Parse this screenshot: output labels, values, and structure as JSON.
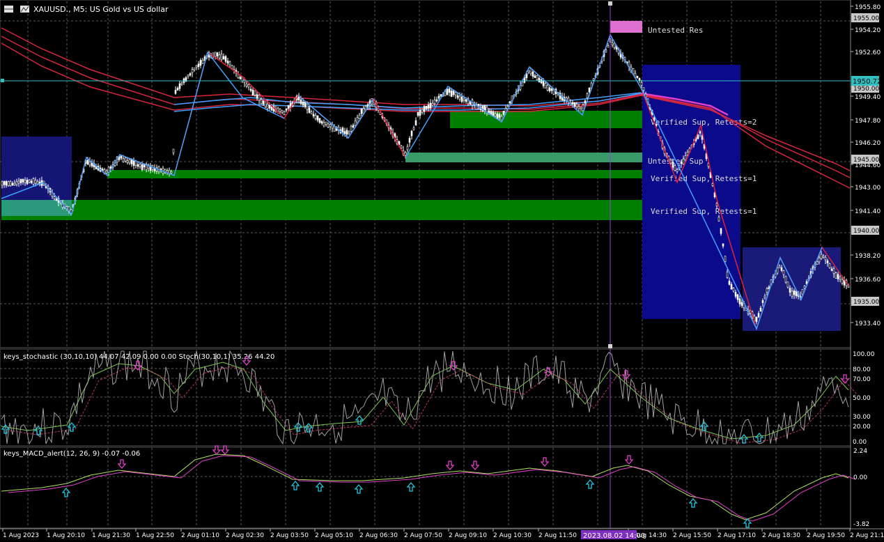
{
  "header": {
    "symbol_title": "XAUUSD., M5:  US Gold vs US dollar"
  },
  "colors": {
    "background": "#000000",
    "grid": "#787878",
    "candle": "#ffffff",
    "ema_red": "#d7263d",
    "ema_blue": "#3ea0ff",
    "magenta": "#e040c8",
    "supply_zone": "#e46fd0",
    "demand_zone": "#008000",
    "untested_sup": "#3aa070",
    "session_box": "#0a0a80",
    "arrow_up": "#22c8e0",
    "arrow_down": "#e040c8",
    "stoch_main": "#7cc84a",
    "stoch_signal": "#c03060",
    "stoch_raw": "#a0a0a0",
    "macd_main": "#b0e060",
    "macd_signal": "#e040c8",
    "crosshair": "#a040e0",
    "current_price_line": "#30c0c0"
  },
  "main_chart": {
    "price_labels": [
      "1955.80",
      "1954.20",
      "1952.60",
      "1949.40",
      "1947.80",
      "1946.20",
      "1944.60",
      "1943.00",
      "1941.40",
      "1938.20",
      "1936.60",
      "1933.40"
    ],
    "highlighted_price_labels": [
      "1955.00",
      "1950.00",
      "1945.00",
      "1940.00",
      "1935.00"
    ],
    "current_price": "1950.72",
    "zone_labels": {
      "untested_res": "Untested Res",
      "verified_sup_2": "Verified Sup, Retests=2",
      "untested_sup": "Untested Sup",
      "verified_sup_1a": "Verified Sup, Retests=1",
      "verified_sup_1b": "Verified Sup, Retests=1"
    }
  },
  "stochastic": {
    "title": "keys_stochastic (30,10,10) 44.07 42.09 0.00 0.00  Stoch(30,10,1) 35.26 44.20",
    "levels": [
      "100.00",
      "80.00",
      "70.00",
      "50.00",
      "30.00",
      "20.00",
      "0.00"
    ]
  },
  "macd": {
    "title": "keys_MACD_alert(12, 26, 9) -0.07 -0.06",
    "levels": [
      "2.24",
      "0.00",
      "-3.82"
    ]
  },
  "time_axis": {
    "labels": [
      "1 Aug 2023",
      "1 Aug 20:10",
      "1 Aug 21:30",
      "1 Aug 22:50",
      "2 Aug 01:10",
      "2 Aug 02:30",
      "2 Aug 03:50",
      "2 Aug 05:10",
      "2 Aug 06:30",
      "2 Aug 07:50",
      "2 Aug 09:10",
      "2 Aug 10:30",
      "2 Aug 11:50",
      "2 Aug 14:30",
      "2 Aug 15:50",
      "2 Aug 17:10",
      "2 Aug 18:30",
      "2 Aug 19:50",
      "2 Aug 21:10"
    ],
    "crosshair_time": "2023.08.02 14:00"
  }
}
